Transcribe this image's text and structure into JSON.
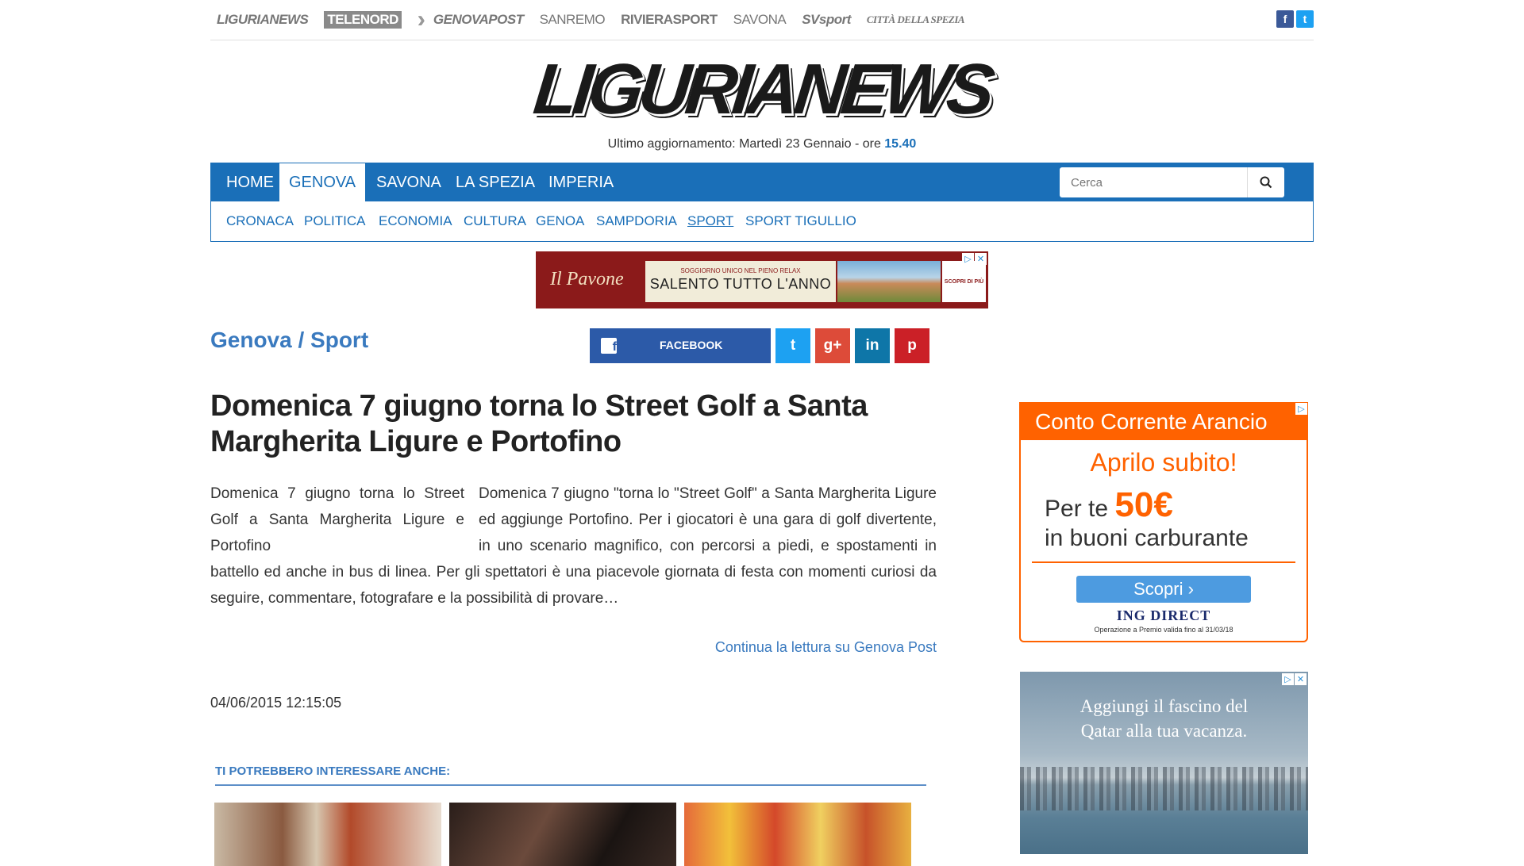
{
  "network": {
    "brands": [
      "LIGURIANEWS",
      "TELENORD",
      "GENOVAPOST",
      "SANREMO",
      "RIVIERASPORT",
      "SAVONA",
      "SVsport",
      "CITTÀ DELLA SPEZIA"
    ],
    "social": {
      "facebook": "f",
      "twitter": "t"
    }
  },
  "site": {
    "logo": "LIGURIANEWS",
    "updated_prefix": "Ultimo aggiornamento: Martedì 23 Gennaio - ore ",
    "updated_time": "15.40"
  },
  "nav": {
    "primary": [
      "HOME",
      "GENOVA",
      "SAVONA",
      "LA SPEZIA",
      "IMPERIA"
    ],
    "active": "GENOVA",
    "search_placeholder": "Cerca",
    "secondary": [
      "CRONACA",
      "POLITICA",
      "ECONOMIA",
      "CULTURA",
      "GENOA",
      "SAMPDORIA",
      "SPORT",
      "SPORT TIGULLIO"
    ]
  },
  "banner_ad": {
    "brand": "Il Pavone",
    "tagline": "SOGGIORNO UNICO NEL PIENO RELAX",
    "headline": "SALENTO TUTTO L'ANNO",
    "cta": "SCOPRI DI PIÙ"
  },
  "breadcrumb": "Genova / Sport",
  "share": {
    "facebook_label": "FACEBOOK",
    "twitter": "t",
    "googleplus": "g+",
    "linkedin": "in",
    "pinterest": "p"
  },
  "article": {
    "title": "Domenica 7 giugno torna lo Street Golf a Santa Margherita Ligure e Portofino",
    "image_alt": "Domenica 7 giugno torna lo Street Golf a Santa Margherita Ligure e Portofino",
    "body": "Domenica 7 giugno \"torna lo \"Street Golf\" a Santa Margherita Ligure ed aggiunge Portofino. Per i giocatori è una gara di golf divertente, in uno scenario magnifico, con percorsi a piedi, e spostamenti in battello ed anche in bus di linea. Per gli spettatori è una piacevole giornata di festa con momenti curiosi da seguire, commentare, fotografare e la possibilità di provare…",
    "read_more": "Continua la lettura su Genova Post",
    "date": "04/06/2015 12:15:05"
  },
  "related": {
    "heading": "TI POTREBBERO INTERESSARE ANCHE:"
  },
  "side_ad_1": {
    "header": "Conto Corrente Arancio",
    "line1": "Aprilo subito!",
    "line2_prefix": "Per te ",
    "line2_amount": "50€",
    "line3": "in buoni carburante",
    "button": "Scopri",
    "brand": "ING DIRECT",
    "fine_print": "Operazione a Premio valida fino al 31/03/18"
  },
  "side_ad_2": {
    "line1": "Aggiungi il fascino del",
    "line2": "Qatar alla tua vacanza."
  },
  "colors": {
    "primary_blue": "#1a6fb8",
    "ing_orange": "#ff6200"
  }
}
